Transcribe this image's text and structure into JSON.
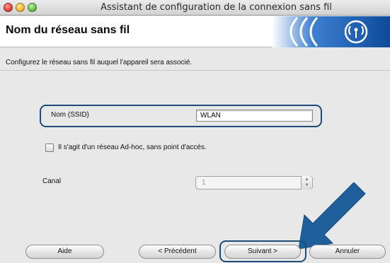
{
  "window": {
    "title": "Assistant de configuration de la connexion sans fil"
  },
  "header": {
    "title": "Nom du réseau sans fil",
    "logo_icon": "wireless-signal-icon"
  },
  "instruction": "Configurez le réseau sans fil auquel l'appareil sera associé.",
  "ssid": {
    "label": "Nom (SSID)",
    "value": "WLAN"
  },
  "adhoc": {
    "label": "Il s'agit d'un réseau Ad-hoc, sans point d'accès.",
    "checked": false
  },
  "canal": {
    "label": "Canal",
    "value": "1",
    "enabled": false
  },
  "buttons": {
    "aide": "Aide",
    "precedent": "< Précédent",
    "suivant": "Suivant >",
    "annuler": "Annuler"
  },
  "colors": {
    "highlight": "#1b4d7a",
    "arrow": "#1f5f9c",
    "logo_blue": "#1a5aa8"
  }
}
